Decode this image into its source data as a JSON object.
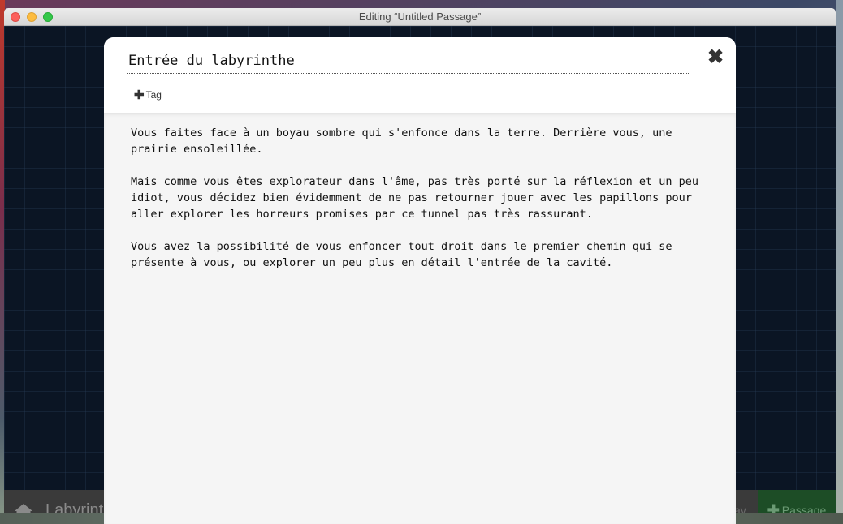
{
  "window": {
    "title": "Editing “Untitled Passage”"
  },
  "story_bar": {
    "story_name": "Labyrinthe",
    "play_label_fragment": "ay",
    "add_passage_label": "Passage",
    "add_passage_color": "#1d4d26"
  },
  "passage_editor": {
    "name_value": "Entrée du labyrinthe",
    "add_tag_label": "Tag",
    "close_icon": "close-icon",
    "paragraphs": [
      "Vous faites face à un boyau sombre qui s'enfonce dans la terre. Derrière vous, une prairie ensoleillée.",
      "Mais comme vous êtes explorateur dans l'âme, pas très porté sur la réflexion et un peu idiot, vous décidez bien évidemment de ne pas retourner jouer avec les papillons pour aller explorer les horreurs promises par ce tunnel pas très rassurant.",
      "Vous avez la possibilité de vous enfoncer tout droit dans le premier chemin qui se présente à vous, ou explorer un peu plus en détail l'entrée de la cavité."
    ]
  }
}
